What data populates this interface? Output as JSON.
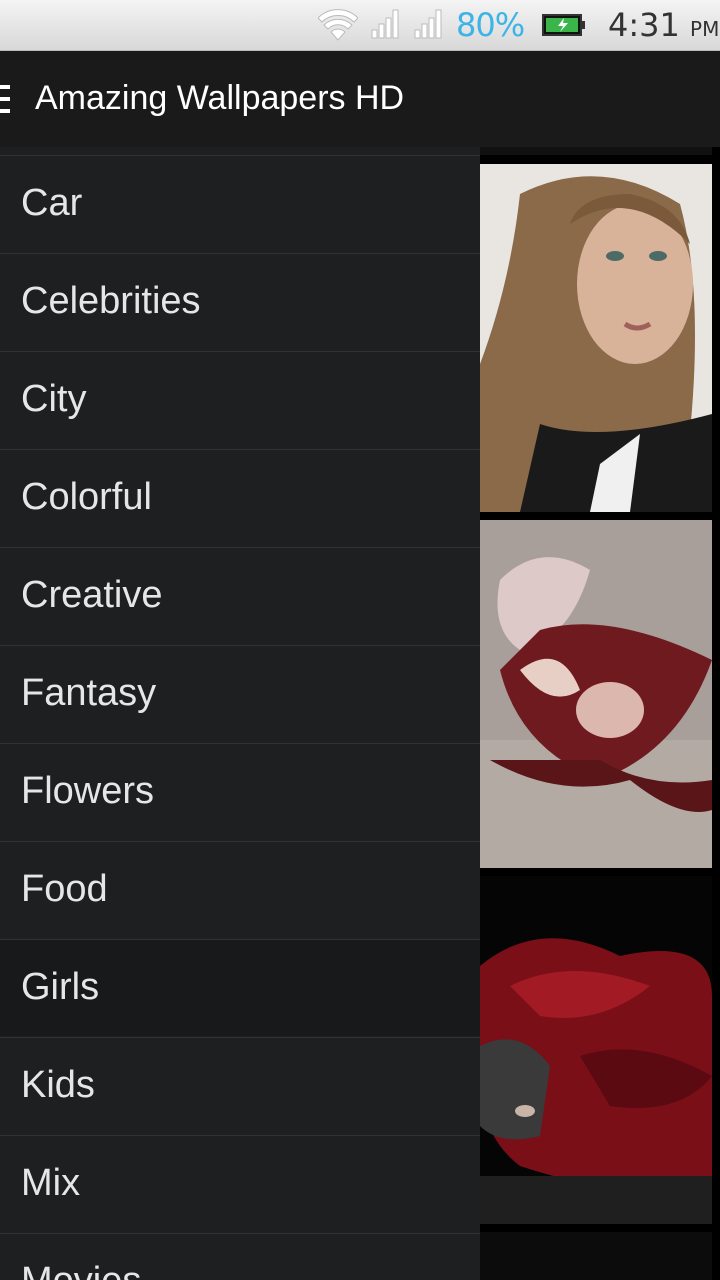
{
  "status_bar": {
    "battery_percent": "80%",
    "time": "4:31",
    "ampm": "PM",
    "icons": [
      "wifi-icon",
      "signal-icon",
      "signal-icon",
      "battery-charging-icon"
    ]
  },
  "action_bar": {
    "title": "Amazing Wallpapers HD",
    "menu_icon": "hamburger-menu-icon"
  },
  "drawer": {
    "items": [
      {
        "label": "Car"
      },
      {
        "label": "Celebrities"
      },
      {
        "label": "City"
      },
      {
        "label": "Colorful"
      },
      {
        "label": "Creative"
      },
      {
        "label": "Fantasy"
      },
      {
        "label": "Flowers"
      },
      {
        "label": "Food"
      },
      {
        "label": "Girls",
        "selected": true
      },
      {
        "label": "Kids"
      },
      {
        "label": "Mix"
      },
      {
        "label": "Movies"
      }
    ]
  },
  "colors": {
    "drawer_bg": "#1e1f21",
    "action_bar_bg": "#1a1a1a",
    "battery_text": "#3cb4e6"
  }
}
